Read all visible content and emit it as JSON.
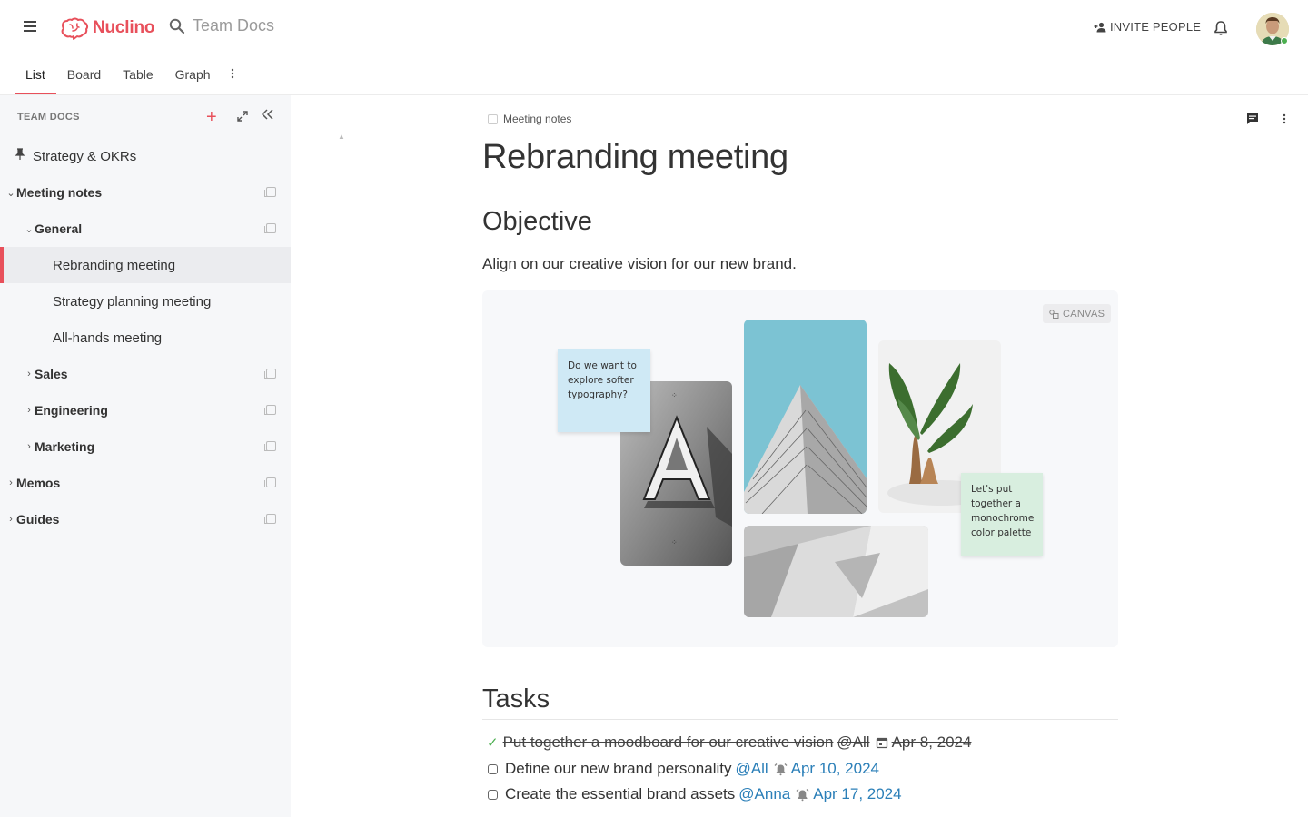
{
  "header": {
    "app_name": "Nuclino",
    "search_placeholder": "Team Docs",
    "invite_label": "INVITE PEOPLE"
  },
  "tabs": [
    {
      "label": "List",
      "active": true
    },
    {
      "label": "Board",
      "active": false
    },
    {
      "label": "Table",
      "active": false
    },
    {
      "label": "Graph",
      "active": false
    }
  ],
  "sidebar": {
    "title": "TEAM DOCS",
    "items": [
      {
        "label": "Strategy & OKRs",
        "icon": "pin-icon"
      },
      {
        "label": "Meeting notes",
        "expanded": true
      },
      {
        "label": "General",
        "expanded": true
      },
      {
        "label": "Rebranding meeting",
        "selected": true
      },
      {
        "label": "Strategy planning meeting"
      },
      {
        "label": "All-hands meeting"
      },
      {
        "label": "Sales",
        "expanded": false
      },
      {
        "label": "Engineering",
        "expanded": false
      },
      {
        "label": "Marketing",
        "expanded": false
      },
      {
        "label": "Memos",
        "expanded": false
      },
      {
        "label": "Guides",
        "expanded": false
      }
    ]
  },
  "doc": {
    "breadcrumb": "Meeting notes",
    "title": "Rebranding meeting",
    "objective_heading": "Objective",
    "objective_text": "Align on our creative vision for our new brand.",
    "canvas_badge": "CANVAS",
    "sticky_notes": [
      "Do we want to explore softer typography?",
      "Let's put together a monochrome color palette"
    ],
    "tasks_heading": "Tasks",
    "tasks": [
      {
        "text": "Put together a moodboard for our creative vision",
        "mention": "@All",
        "date": "Apr 8, 2024",
        "done": true,
        "date_icon": "calendar-icon"
      },
      {
        "text": "Define our new brand personality",
        "mention": "@All",
        "date": "Apr 10, 2024",
        "done": false,
        "date_icon": "reminder-icon"
      },
      {
        "text": "Create the essential brand assets",
        "mention": "@Anna",
        "date": "Apr 17, 2024",
        "done": false,
        "date_icon": "reminder-icon"
      }
    ]
  },
  "colors": {
    "accent": "#e8505b",
    "link": "#2b7fb8",
    "sidebar_bg": "#f6f7f9",
    "done_check": "#4caf50"
  }
}
